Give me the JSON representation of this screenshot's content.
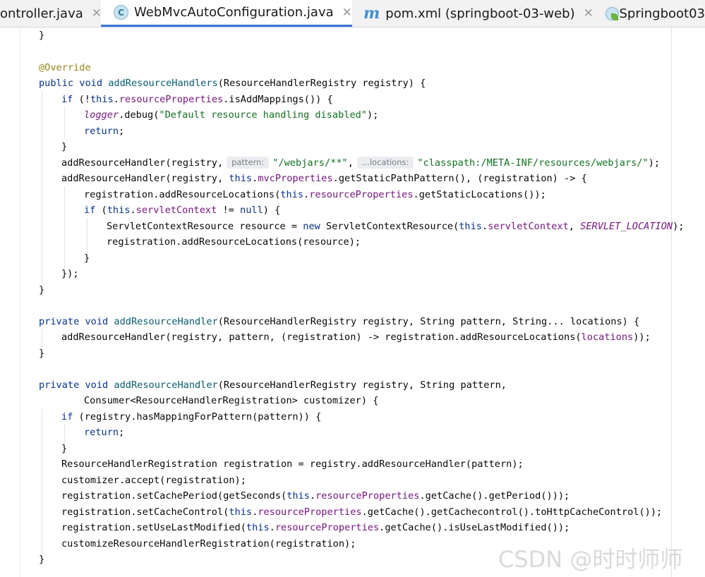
{
  "tabs": [
    {
      "label": "ontroller.java",
      "icon": "none",
      "active": false,
      "close": "✕"
    },
    {
      "label": "WebMvcAutoConfiguration.java",
      "icon": "class-c-icon",
      "icon_glyph": "C",
      "active": true,
      "close": "✕"
    },
    {
      "label": "pom.xml (springboot-03-web)",
      "icon": "maven-m-icon",
      "icon_glyph": "m",
      "active": false,
      "close": "✕"
    },
    {
      "label": "Springboot03",
      "icon": "springboot-class-icon",
      "active": false
    }
  ],
  "code": {
    "l1": "}",
    "l2": "",
    "l3_ann": "@Override",
    "l4": {
      "public": "public",
      "void": "void",
      "name": "addResourceHandlers",
      "rest": "(ResourceHandlerRegistry registry) {"
    },
    "l5": {
      "if": "if",
      "p1": " (!",
      "this": "this",
      "dot": ".",
      "field": "resourceProperties",
      "rest": ".isAddMappings()) {"
    },
    "l6": {
      "logger": "logger",
      "mid": ".debug(",
      "str": "\"Default resource handling disabled\"",
      "end": ");"
    },
    "l7": {
      "ret": "return",
      "end": ";"
    },
    "l8": "}",
    "l9": {
      "p1": "addResourceHandler(registry,",
      "hint1": "pattern:",
      "str1": "\"/webjars/**\"",
      "comma": ",",
      "hint2": "...locations:",
      "str2": "\"classpath:/META-INF/resources/webjars/\"",
      "end": ");"
    },
    "l10": {
      "p1": "addResourceHandler(registry, ",
      "this": "this",
      "dot": ".",
      "field": "mvcProperties",
      "rest": ".getStaticPathPattern(), (registration) -> {"
    },
    "l11": {
      "p1": "registration.addResourceLocations(",
      "this": "this",
      "dot": ".",
      "field": "resourceProperties",
      "rest": ".getStaticLocations());"
    },
    "l12": {
      "if": "if",
      "p1": " (",
      "this": "this",
      "dot": ".",
      "field": "servletContext",
      "mid": " != ",
      "null": "null",
      "end": ") {"
    },
    "l13": {
      "p1": "ServletContextResource resource = ",
      "new": "new",
      "p2": " ServletContextResource(",
      "this": "this",
      "dot": ".",
      "field": "servletContext",
      "comma": ", ",
      "const": "SERVLET_LOCATION",
      "end": ");"
    },
    "l14": "registration.addResourceLocations(resource);",
    "l15": "}",
    "l16": "});",
    "l17": "}",
    "l18": "",
    "l19": {
      "private": "private",
      "void": "void",
      "name": "addResourceHandler",
      "rest": "(ResourceHandlerRegistry registry, String pattern, String... locations) {"
    },
    "l20": {
      "p1": "addResourceHandler(registry, pattern, (registration) -> registration.addResourceLocations(",
      "param": "locations",
      "end": "));"
    },
    "l21": "}",
    "l22": "",
    "l23": {
      "private": "private",
      "void": "void",
      "name": "addResourceHandler",
      "rest": "(ResourceHandlerRegistry registry, String pattern,"
    },
    "l24": "Consumer<ResourceHandlerRegistration> customizer) {",
    "l25": {
      "if": "if",
      "rest": " (registry.hasMappingForPattern(pattern)) {"
    },
    "l26": {
      "ret": "return",
      "end": ";"
    },
    "l27": "}",
    "l28": "ResourceHandlerRegistration registration = registry.addResourceHandler(pattern);",
    "l29": "customizer.accept(registration);",
    "l30": {
      "p1": "registration.setCachePeriod(getSeconds(",
      "this": "this",
      "dot": ".",
      "field": "resourceProperties",
      "rest": ".getCache().getPeriod()));"
    },
    "l31": {
      "p1": "registration.setCacheControl(",
      "this": "this",
      "dot": ".",
      "field": "resourceProperties",
      "rest": ".getCache().getCachecontrol().toHttpCacheControl());"
    },
    "l32": {
      "p1": "registration.setUseLastModified(",
      "this": "this",
      "dot": ".",
      "field": "resourceProperties",
      "rest": ".getCache().isUseLastModified());"
    },
    "l33": "customizeResourceHandlerRegistration(registration);",
    "l34": "}"
  },
  "watermark": "CSDN @时时师师",
  "colors": {
    "keyword": "#0033b3",
    "field": "#871094",
    "string": "#067d17",
    "annotation": "#9e880d",
    "method_decl": "#00627a",
    "tab_underline": "#3574f0"
  }
}
